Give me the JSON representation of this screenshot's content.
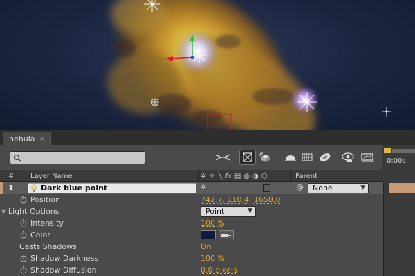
{
  "composition": {
    "tab_label": "nebula",
    "tab_close": "×"
  },
  "toolbar": {
    "search_placeholder": "",
    "buttons": [
      "composition-mini-flowchart",
      "draft-3d",
      "hide-shy-layers",
      "frame-blending",
      "motion-blur",
      "brainstorm",
      "auto-keyframe",
      "graph-editor",
      "comp-flowchart"
    ]
  },
  "timeline": {
    "time_label": "0:00s"
  },
  "columns": {
    "hash": "#",
    "layer_name": "Layer Name",
    "parent": "Parent",
    "switch_icons": [
      "✲",
      "☼",
      "╲",
      "fx",
      "▤",
      "◍",
      "◑",
      "⬡"
    ]
  },
  "layer": {
    "number": "1",
    "name": "Dark blue point",
    "parent_value": "None",
    "spiral_symbol": "@"
  },
  "properties": [
    {
      "label": "Position",
      "value": "742,7, 110,4, 1658,0"
    },
    {
      "label": "Light Options",
      "value": "Point"
    },
    {
      "label": "Intensity",
      "value": "100 %"
    },
    {
      "label": "Color",
      "value": ""
    },
    {
      "label": "Casts Shadows",
      "value": "On"
    },
    {
      "label": "Shadow Darkness",
      "value": "100 %"
    },
    {
      "label": "Shadow Diffusion",
      "value": "0,0 pixels"
    }
  ],
  "colors": {
    "panel_bg": "#4a4a4a",
    "value_orange": "#e3a73a",
    "light_color": "#0f1c3e",
    "label_chip": "#c89a7a",
    "viewer_bg": "#1b2540"
  }
}
